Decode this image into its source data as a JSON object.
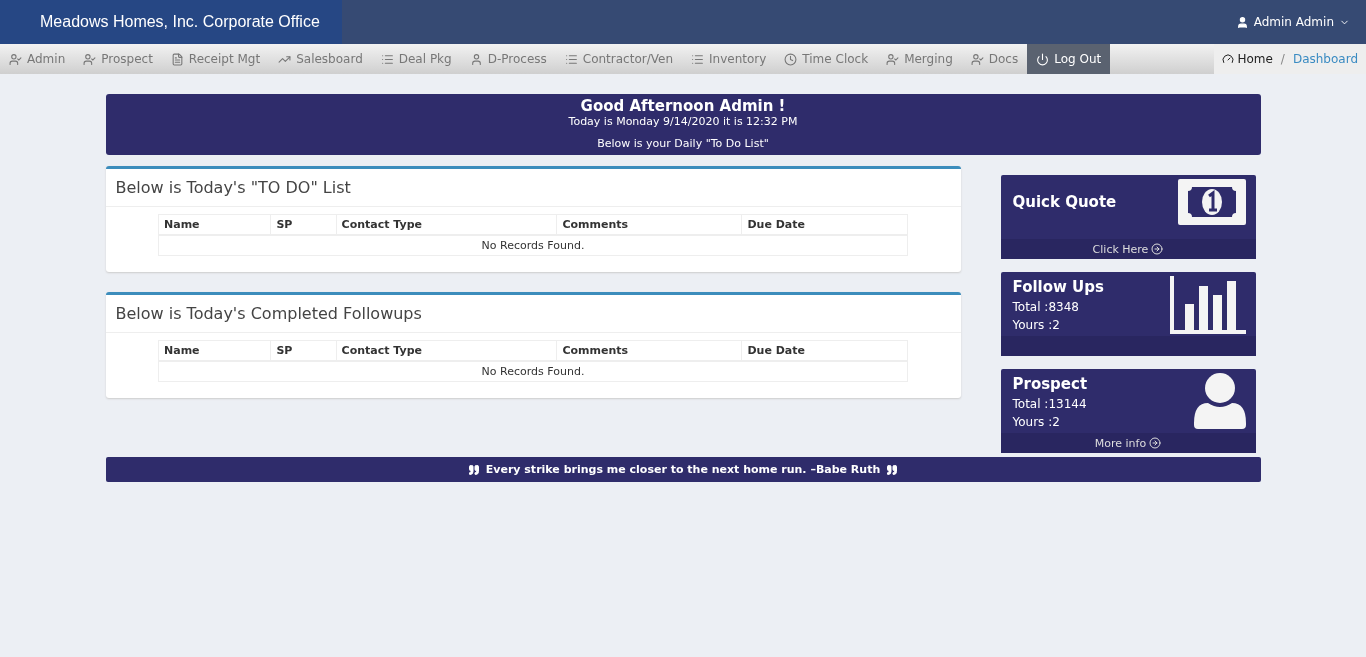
{
  "header": {
    "brand": "Meadows Homes, Inc. Corporate Office",
    "user": "Admin Admin"
  },
  "nav": [
    {
      "label": "Admin",
      "kind": "person",
      "selected": false
    },
    {
      "label": "Prospect",
      "kind": "person",
      "selected": false
    },
    {
      "label": "Receipt Mgt",
      "kind": "document",
      "selected": false
    },
    {
      "label": "Salesboard",
      "kind": "trend",
      "selected": false
    },
    {
      "label": "Deal Pkg",
      "kind": "list",
      "selected": false
    },
    {
      "label": "D-Process",
      "kind": "user",
      "selected": false
    },
    {
      "label": "Contractor/Ven",
      "kind": "list",
      "selected": false
    },
    {
      "label": "Inventory",
      "kind": "list",
      "selected": false
    },
    {
      "label": "Time Clock",
      "kind": "clock",
      "selected": false
    },
    {
      "label": "Merging",
      "kind": "person",
      "selected": false
    },
    {
      "label": "Docs",
      "kind": "person",
      "selected": false
    },
    {
      "label": "Log Out",
      "kind": "power",
      "selected": true
    }
  ],
  "breadcrumb": {
    "separator": "/",
    "items": [
      {
        "label": "Home",
        "current": true
      },
      {
        "label": "Dashboard",
        "current": false
      }
    ]
  },
  "banner": {
    "greeting": "Good Afternoon Admin !",
    "date_line": "Today is Monday 9/14/2020 it is 12:32 PM",
    "note": "Below is your Daily \"To Do List\""
  },
  "panels": [
    {
      "title": "Below is Today's \"TO DO\" List",
      "columns": [
        "Name",
        "SP",
        "Contact Type",
        "Comments",
        "Due Date"
      ],
      "empty": "No Records Found."
    },
    {
      "title": "Below is Today's Completed Followups",
      "columns": [
        "Name",
        "SP",
        "Contact Type",
        "Comments",
        "Due Date"
      ],
      "empty": "No Records Found."
    }
  ],
  "stat_cards": [
    {
      "title": "Quick Quote",
      "kind": "money",
      "footer": "Click Here"
    },
    {
      "title": "Follow Ups",
      "kind": "chart",
      "lines": [
        "Total :8348",
        "Yours :2"
      ]
    },
    {
      "title": "Prospect",
      "kind": "user",
      "lines": [
        "Total :13144",
        "Yours :2"
      ],
      "footer": "More info"
    }
  ],
  "quote": "Every strike brings me closer to the next home run. –Babe Ruth"
}
